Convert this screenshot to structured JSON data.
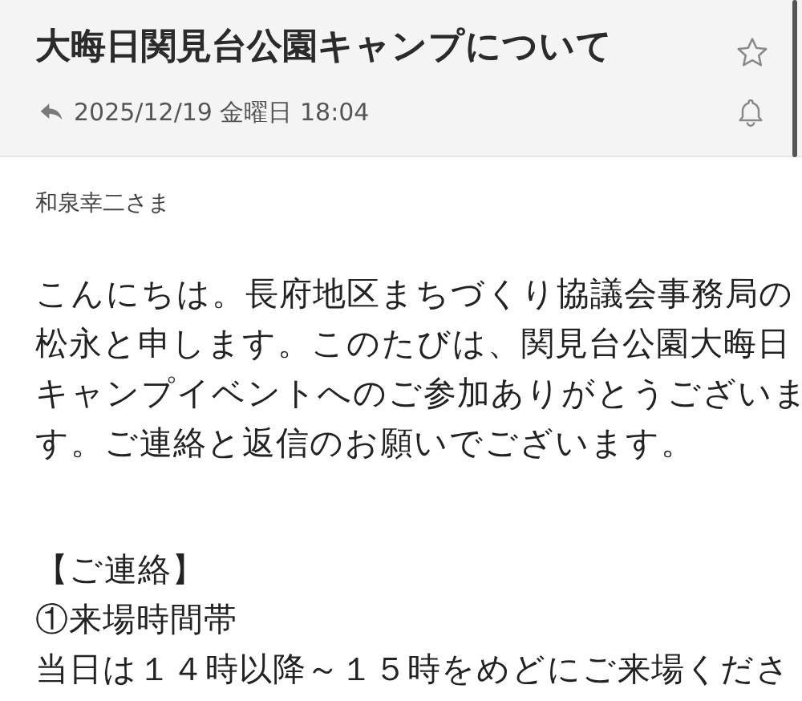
{
  "header": {
    "subject": "大晦日関見台公園キャンプについて",
    "starred": false,
    "date": "2025/12/19 金曜日 18:04"
  },
  "body": {
    "greeting": "和泉幸二さま",
    "paragraph_lines": [
      "こんにちは。長府地区まちづくり協議会事務局の",
      "松永と申します。このたびは、関見台公園大晦日",
      "キャンプイベントへのご参加ありがとうございま",
      "す。ご連絡と返信のお願いでございます。"
    ],
    "section_heading": "【ご連絡】",
    "item_heading": "①来場時間帯",
    "item_text": "当日は１４時以降～１５時をめどにご来場くださ"
  }
}
